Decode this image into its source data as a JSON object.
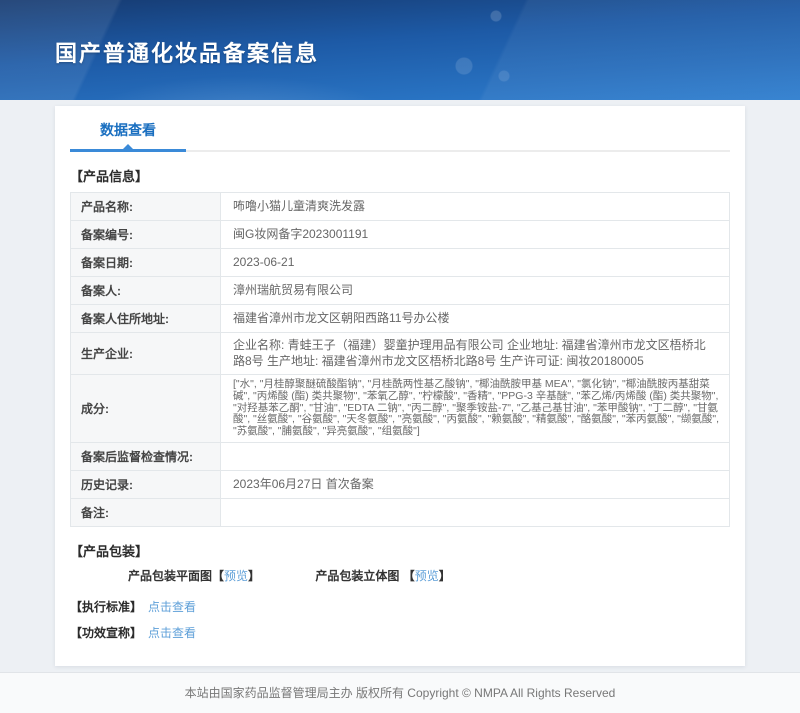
{
  "header": {
    "title": "国产普通化妆品备案信息"
  },
  "tabs": {
    "data_view": "数据查看"
  },
  "product_info": {
    "section_title": "【产品信息】",
    "rows": [
      {
        "label": "产品名称:",
        "value": "咘噜小猫儿童清爽洗发露"
      },
      {
        "label": "备案编号:",
        "value": "闽G妆网备字2023001191"
      },
      {
        "label": "备案日期:",
        "value": "2023-06-21"
      },
      {
        "label": "备案人:",
        "value": "漳州瑞航贸易有限公司"
      },
      {
        "label": "备案人住所地址:",
        "value": "福建省漳州市龙文区朝阳西路11号办公楼"
      },
      {
        "label": "生产企业:",
        "value": "企业名称: 青蛙王子（福建）婴童护理用品有限公司 企业地址: 福建省漳州市龙文区梧桥北路8号 生产地址: 福建省漳州市龙文区梧桥北路8号 生产许可证: 闽妆20180005"
      },
      {
        "label": "成分:",
        "value": "[\"水\", \"月桂醇聚醚硫酸酯钠\", \"月桂酰两性基乙酸钠\", \"椰油酰胺甲基 MEA\", \"氯化钠\", \"椰油酰胺丙基甜菜碱\", \"丙烯酸 (酯) 类共聚物\", \"苯氧乙醇\", \"柠檬酸\", \"香精\", \"PPG-3 辛基醚\", \"苯乙烯/丙烯酸 (酯) 类共聚物\", \"对羟基苯乙酮\", \"甘油\", \"EDTA 二钠\", \"丙二醇\", \"聚季铵盐-7\", \"乙基己基甘油\", \"苯甲酸钠\", \"丁二醇\", \"甘氨酸\", \"丝氨酸\", \"谷氨酸\", \"天冬氨酸\", \"亮氨酸\", \"丙氨酸\", \"赖氨酸\", \"精氨酸\", \"酪氨酸\", \"苯丙氨酸\", \"缬氨酸\", \"苏氨酸\", \"脯氨酸\", \"异亮氨酸\", \"组氨酸\"]"
      },
      {
        "label": "备案后监督检查情况:",
        "value": ""
      },
      {
        "label": "历史记录:",
        "value": "2023年06月27日 首次备案"
      },
      {
        "label": "备注:",
        "value": ""
      }
    ]
  },
  "packaging": {
    "section_title": "【产品包装】",
    "items": [
      {
        "label": "产品包装平面图",
        "bracket_open": "【",
        "link": "预览",
        "bracket_close": "】"
      },
      {
        "label": "产品包装立体图 ",
        "bracket_open": "【",
        "link": "预览",
        "bracket_close": "】"
      }
    ]
  },
  "standards": {
    "label": "【执行标准】",
    "link": "点击查看"
  },
  "efficacy": {
    "label": "【功效宣称】",
    "link": "点击查看"
  },
  "footer": {
    "text": "本站由国家药品监督管理局主办 版权所有 Copyright © NMPA All Rights Reserved"
  },
  "colors": {
    "header_gradient_top": "#163a70",
    "header_gradient_bottom": "#2e7ecf",
    "tab_blue": "#1a6fc0",
    "tab_underline": "#3a8ad8",
    "link_blue": "#5e9fd8",
    "label_cell_bg": "#f6f7f8",
    "page_bg": "#edf0f4"
  }
}
